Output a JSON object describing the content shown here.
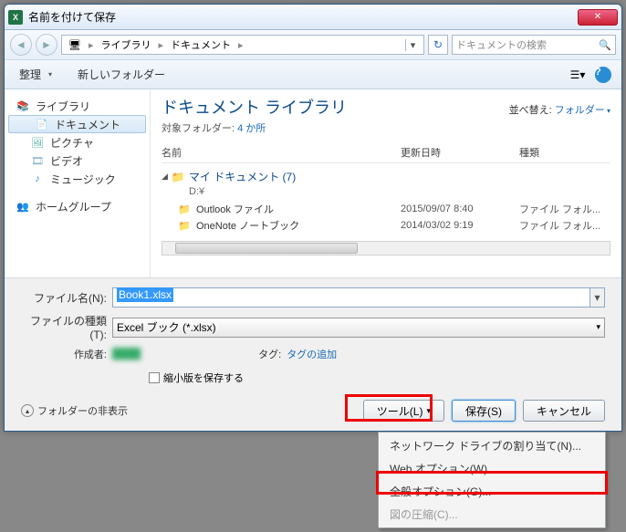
{
  "window": {
    "title": "名前を付けて保存"
  },
  "nav": {
    "breadcrumb": [
      "ライブラリ",
      "ドキュメント"
    ],
    "search_placeholder": "ドキュメントの検索"
  },
  "toolbar": {
    "organize": "整理",
    "new_folder": "新しいフォルダー"
  },
  "sidebar": {
    "library": "ライブラリ",
    "documents": "ドキュメント",
    "pictures": "ピクチャ",
    "videos": "ビデオ",
    "music": "ミュージック",
    "homegroup": "ホームグループ"
  },
  "main": {
    "lib_title": "ドキュメント ライブラリ",
    "lib_sub_prefix": "対象フォルダー: ",
    "lib_sub_link": "4 か所",
    "sort_label": "並べ替え:",
    "sort_value": "フォルダー",
    "cols": {
      "name": "名前",
      "date": "更新日時",
      "type": "種類"
    },
    "group": {
      "label": "マイ ドキュメント (7)",
      "path": "D:¥"
    },
    "files": [
      {
        "name": "Outlook ファイル",
        "date": "2015/09/07 8:40",
        "type": "ファイル フォル..."
      },
      {
        "name": "OneNote ノートブック",
        "date": "2014/03/02 9:19",
        "type": "ファイル フォル..."
      }
    ]
  },
  "form": {
    "filename_label": "ファイル名(N):",
    "filename_value": "Book1.xlsx",
    "filetype_label": "ファイルの種類(T):",
    "filetype_value": "Excel ブック (*.xlsx)",
    "author_label": "作成者:",
    "author_value": "████",
    "tag_label": "タグ:",
    "tag_value": "タグの追加",
    "thumbnail_label": "縮小版を保存する",
    "hide_folders": "フォルダーの非表示",
    "tools_btn": "ツール(L)",
    "save_btn": "保存(S)",
    "cancel_btn": "キャンセル"
  },
  "menu": {
    "items": [
      "ネットワーク ドライブの割り当て(N)...",
      "Web オプション(W)...",
      "全般オプション(G)...",
      "図の圧縮(C)..."
    ]
  }
}
